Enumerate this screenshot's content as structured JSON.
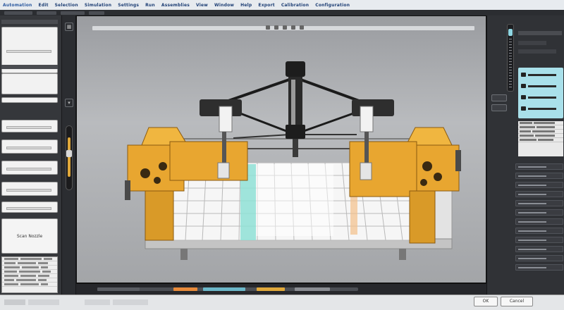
{
  "menubar": {
    "items": [
      "Automation",
      "Edit",
      "Selection",
      "Simulation",
      "Settings",
      "Run",
      "Assemblies",
      "View",
      "Window",
      "Help",
      "Export",
      "Calibration",
      "Configuration"
    ]
  },
  "left_panel": {
    "preview_label": "Scan Nozzle"
  },
  "status_bar": {
    "ok_button": "OK",
    "cancel_button": "Cancel"
  },
  "colors": {
    "accent": "#e8a630",
    "selection": "#8fe0d6",
    "highlight": "#f3c08a"
  }
}
